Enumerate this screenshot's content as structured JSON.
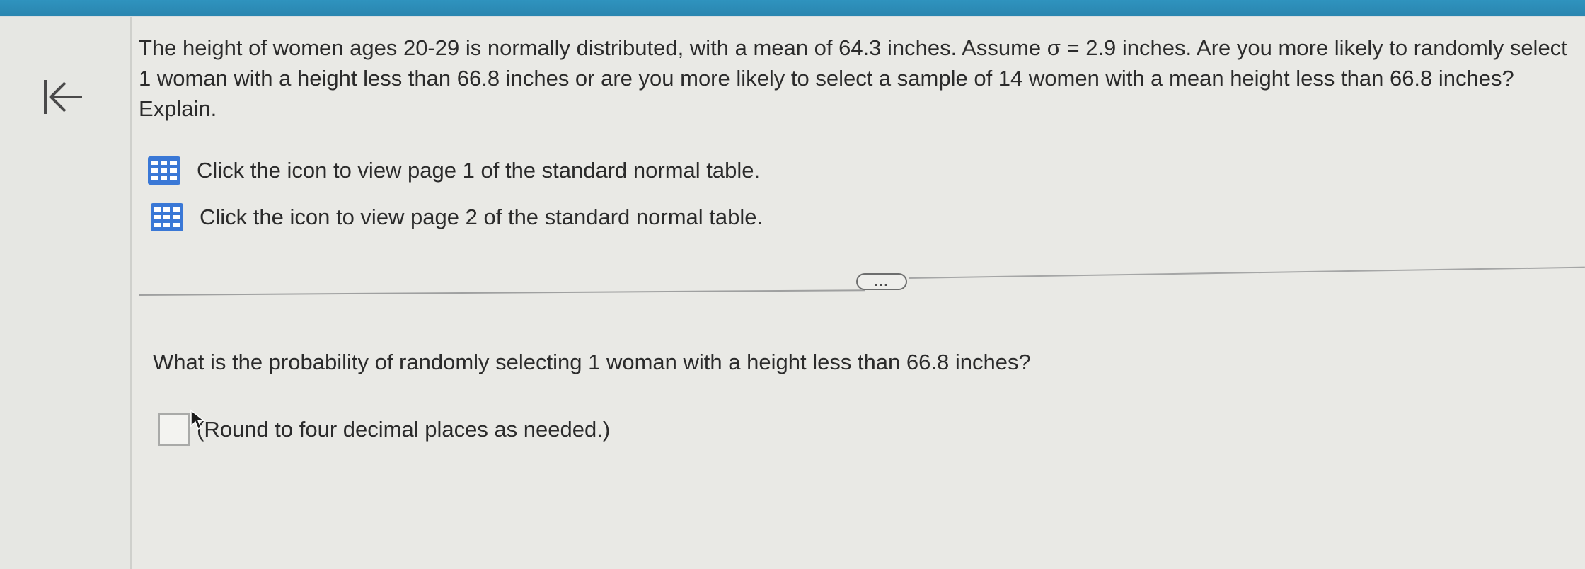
{
  "nav": {
    "back_icon": "first-page-arrow-icon"
  },
  "question": {
    "text": "The height of women ages 20-29 is normally distributed, with a mean of 64.3 inches. Assume σ = 2.9 inches. Are you more likely to randomly select 1 woman with a height less than 66.8 inches or are you more likely to select a sample of 14 women with a mean height less than 66.8 inches? Explain."
  },
  "table_links": [
    {
      "icon": "table-icon",
      "label": "Click the icon to view page 1 of the standard normal table."
    },
    {
      "icon": "table-icon",
      "label": "Click the icon to view page 2 of the standard normal table."
    }
  ],
  "divider": {
    "more_label": "..."
  },
  "part": {
    "question": "What is the probability of randomly selecting 1 woman with a height less than 66.8 inches?",
    "answer_value": "",
    "hint": "(Round to four decimal places as needed.)"
  },
  "colors": {
    "top_bar": "#2f93be",
    "icon_blue": "#3a78d6",
    "background": "#e9e9e5"
  }
}
